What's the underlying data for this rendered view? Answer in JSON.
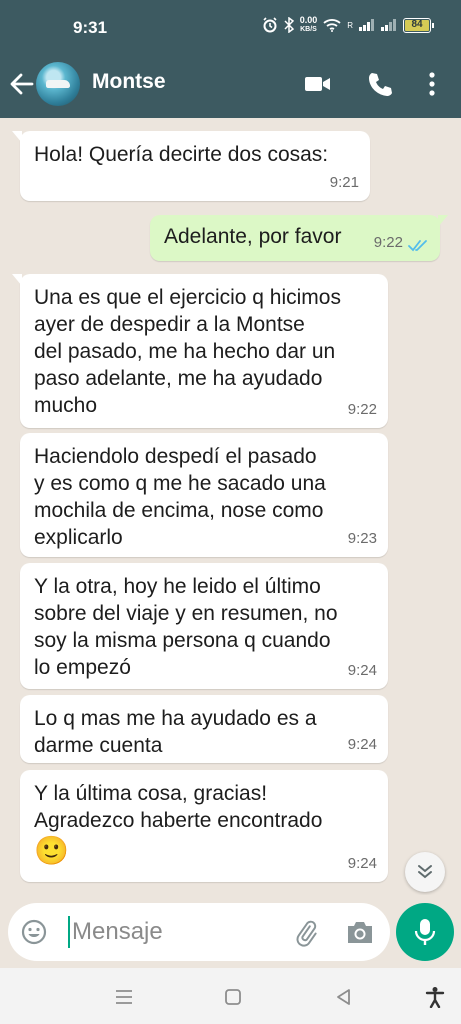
{
  "status_bar": {
    "time": "9:31",
    "net_speed_value": "0.00",
    "net_speed_unit": "KB/S",
    "signal_label": "R",
    "battery_level": "84"
  },
  "header": {
    "contact_name": "Montse"
  },
  "messages": [
    {
      "direction": "in",
      "text": "Hola! Quería decirte dos cosas:",
      "time": "9:21"
    },
    {
      "direction": "out",
      "text": "Adelante, por favor",
      "time": "9:22",
      "status": "read"
    },
    {
      "direction": "in",
      "text": "Una es que el ejercicio q hicimos\nayer de despedir a la Montse\ndel pasado, me ha hecho dar un\npaso adelante, me ha ayudado\nmucho",
      "time": "9:22"
    },
    {
      "direction": "in",
      "text": "Haciendolo despedí el pasado\ny es como q me he sacado una\nmochila de encima, nose como\nexplicarlo",
      "time": "9:23"
    },
    {
      "direction": "in",
      "text": "Y la otra, hoy he leido el último\nsobre del viaje y en resumen, no\nsoy la misma persona q cuando\nlo empezó",
      "time": "9:24"
    },
    {
      "direction": "in",
      "text": "Lo q mas me ha ayudado es a\ndarme cuenta",
      "time": "9:24"
    },
    {
      "direction": "in",
      "text": "Y la última cosa, gracias!\nAgradezco haberte encontrado",
      "emoji": "🙂",
      "time": "9:24"
    }
  ],
  "composer": {
    "placeholder": "Mensaje"
  },
  "colors": {
    "header": "#3d5a61",
    "outgoing_bubble": "#dcf8c6",
    "accent": "#00a884",
    "read_ticks": "#53bdeb"
  }
}
